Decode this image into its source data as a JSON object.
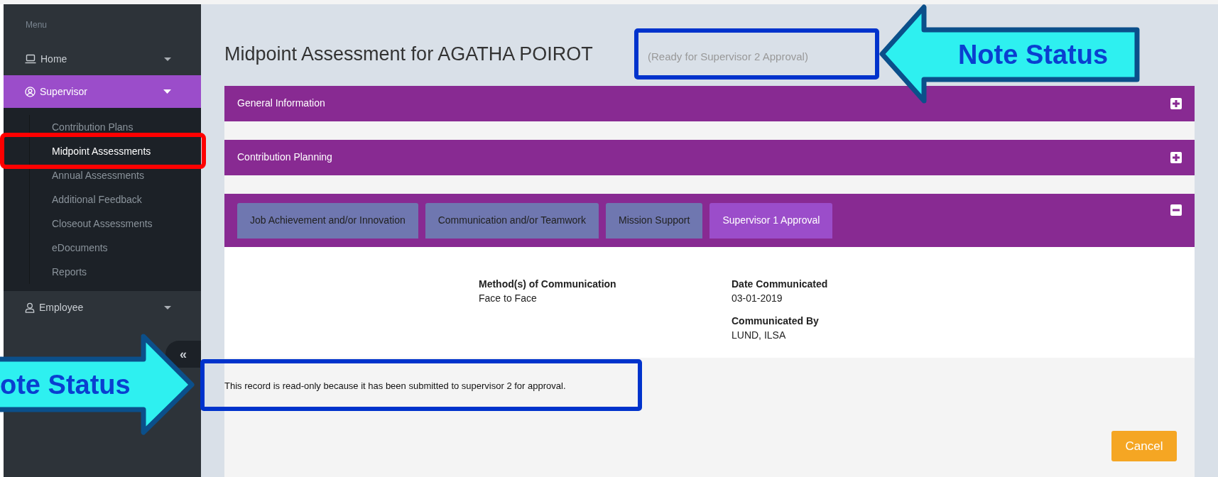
{
  "sidebar": {
    "heading": "Menu",
    "items": [
      {
        "label": "Home",
        "selected": false,
        "expanded": false
      },
      {
        "label": "Supervisor",
        "selected": true,
        "expanded": true,
        "children": [
          {
            "label": "Contribution Plans",
            "selected": false
          },
          {
            "label": "Midpoint Assessments",
            "selected": true
          },
          {
            "label": "Annual Assessments",
            "selected": false
          },
          {
            "label": "Additional Feedback",
            "selected": false
          },
          {
            "label": "Closeout Assessments",
            "selected": false
          },
          {
            "label": "eDocuments",
            "selected": false
          },
          {
            "label": "Reports",
            "selected": false
          }
        ]
      },
      {
        "label": "Employee",
        "selected": false,
        "expanded": false
      }
    ],
    "collapse_button": "«"
  },
  "page": {
    "title": "Midpoint Assessment for AGATHA POIROT",
    "status": "(Ready for Supervisor 2 Approval)",
    "panels": [
      {
        "title": "General Information",
        "expanded": false
      },
      {
        "title": "Contribution Planning",
        "expanded": false
      },
      {
        "expanded": true,
        "tabs": [
          {
            "label": "Job Achievement and/or Innovation",
            "selected": false
          },
          {
            "label": "Communication and/or Teamwork",
            "selected": false
          },
          {
            "label": "Mission Support",
            "selected": false
          },
          {
            "label": "Supervisor 1 Approval",
            "selected": true
          }
        ],
        "columns": [
          [
            {
              "label": "Method(s) of Communication",
              "value": "Face to Face"
            }
          ],
          [
            {
              "label": "Date Communicated",
              "value": "03-01-2019"
            },
            {
              "label": "Communicated By",
              "value": "LUND, ILSA"
            }
          ]
        ]
      }
    ],
    "notice": "This record is read-only because it has been submitted to supervisor 2 for approval.",
    "cancel_button": "Cancel"
  },
  "annotations": [
    {
      "kind": "highlight",
      "color": "#ff0000"
    },
    {
      "kind": "highlight",
      "color": "#0033cc"
    },
    {
      "kind": "highlight",
      "color": "#0033cc"
    },
    {
      "kind": "arrow",
      "label": "Note Status"
    },
    {
      "kind": "arrow",
      "label": "ote Status"
    }
  ]
}
